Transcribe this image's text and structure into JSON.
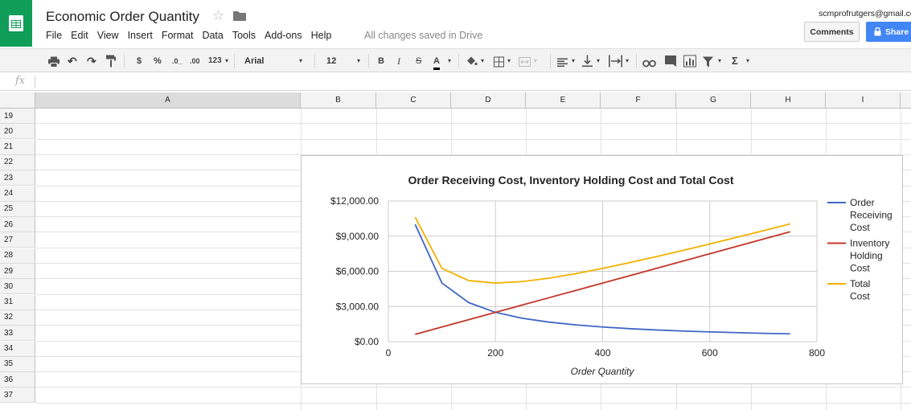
{
  "header": {
    "title": "Economic Order Quantity",
    "saved_status": "All changes saved in Drive",
    "user_email": "scmprofrutgers@gmail.com",
    "comments_label": "Comments",
    "share_label": "Share",
    "star_icon": "star-icon",
    "folder_icon": "folder-icon"
  },
  "menu": [
    "File",
    "Edit",
    "View",
    "Insert",
    "Format",
    "Data",
    "Tools",
    "Add-ons",
    "Help"
  ],
  "toolbar": {
    "currency": "$",
    "percent": "%",
    "decrease_decimals": ".0_",
    "increase_decimals": ".00",
    "more_formats": "123",
    "font": "Arial",
    "font_size": "12",
    "bold": "B",
    "italic": "I",
    "strike": "S",
    "text_color": "A",
    "sum": "Σ"
  },
  "formula_bar": {
    "fx": "fx",
    "value": ""
  },
  "columns": [
    "A",
    "B",
    "C",
    "D",
    "E",
    "F",
    "G",
    "H",
    "I"
  ],
  "rows": [
    "19",
    "20",
    "21",
    "22",
    "23",
    "24",
    "25",
    "26",
    "27",
    "28",
    "29",
    "30",
    "31",
    "32",
    "33",
    "34",
    "35",
    "36",
    "37"
  ],
  "colors": {
    "brand_green": "#0f9d58",
    "share_blue": "#4285f4",
    "series_order": "#3f66c5",
    "series_holding": "#c2362b",
    "series_total": "#f2b000"
  },
  "chart_data": {
    "type": "line",
    "title": "Order Receiving Cost, Inventory Holding Cost and Total Cost",
    "xlabel": "Order Quantity",
    "ylabel": "",
    "xlim": [
      0,
      800
    ],
    "ylim": [
      0,
      12000
    ],
    "x_ticks": [
      "0",
      "200",
      "400",
      "600",
      "800"
    ],
    "y_ticks": [
      "$0.00",
      "$3,000.00",
      "$6,000.00",
      "$9,000.00",
      "$12,000.00"
    ],
    "grid": true,
    "legend_position": "right",
    "x": [
      50,
      100,
      150,
      200,
      250,
      300,
      350,
      400,
      450,
      500,
      550,
      600,
      650,
      700,
      750
    ],
    "series": [
      {
        "name": "Order Receiving Cost",
        "color": "#3f66c5",
        "values": [
          10000,
          5000,
          3333,
          2500,
          2000,
          1667,
          1429,
          1250,
          1111,
          1000,
          909,
          833,
          769,
          714,
          667
        ]
      },
      {
        "name": "Inventory Holding Cost",
        "color": "#c2362b",
        "values": [
          625,
          1250,
          1875,
          2500,
          3125,
          3750,
          4375,
          5000,
          5625,
          6250,
          6875,
          7500,
          8125,
          8750,
          9375
        ]
      },
      {
        "name": "Total Cost",
        "color": "#f2b000",
        "values": [
          10625,
          6250,
          5208,
          5000,
          5125,
          5417,
          5804,
          6250,
          6736,
          7250,
          7784,
          8333,
          8894,
          9464,
          10042
        ]
      }
    ]
  }
}
